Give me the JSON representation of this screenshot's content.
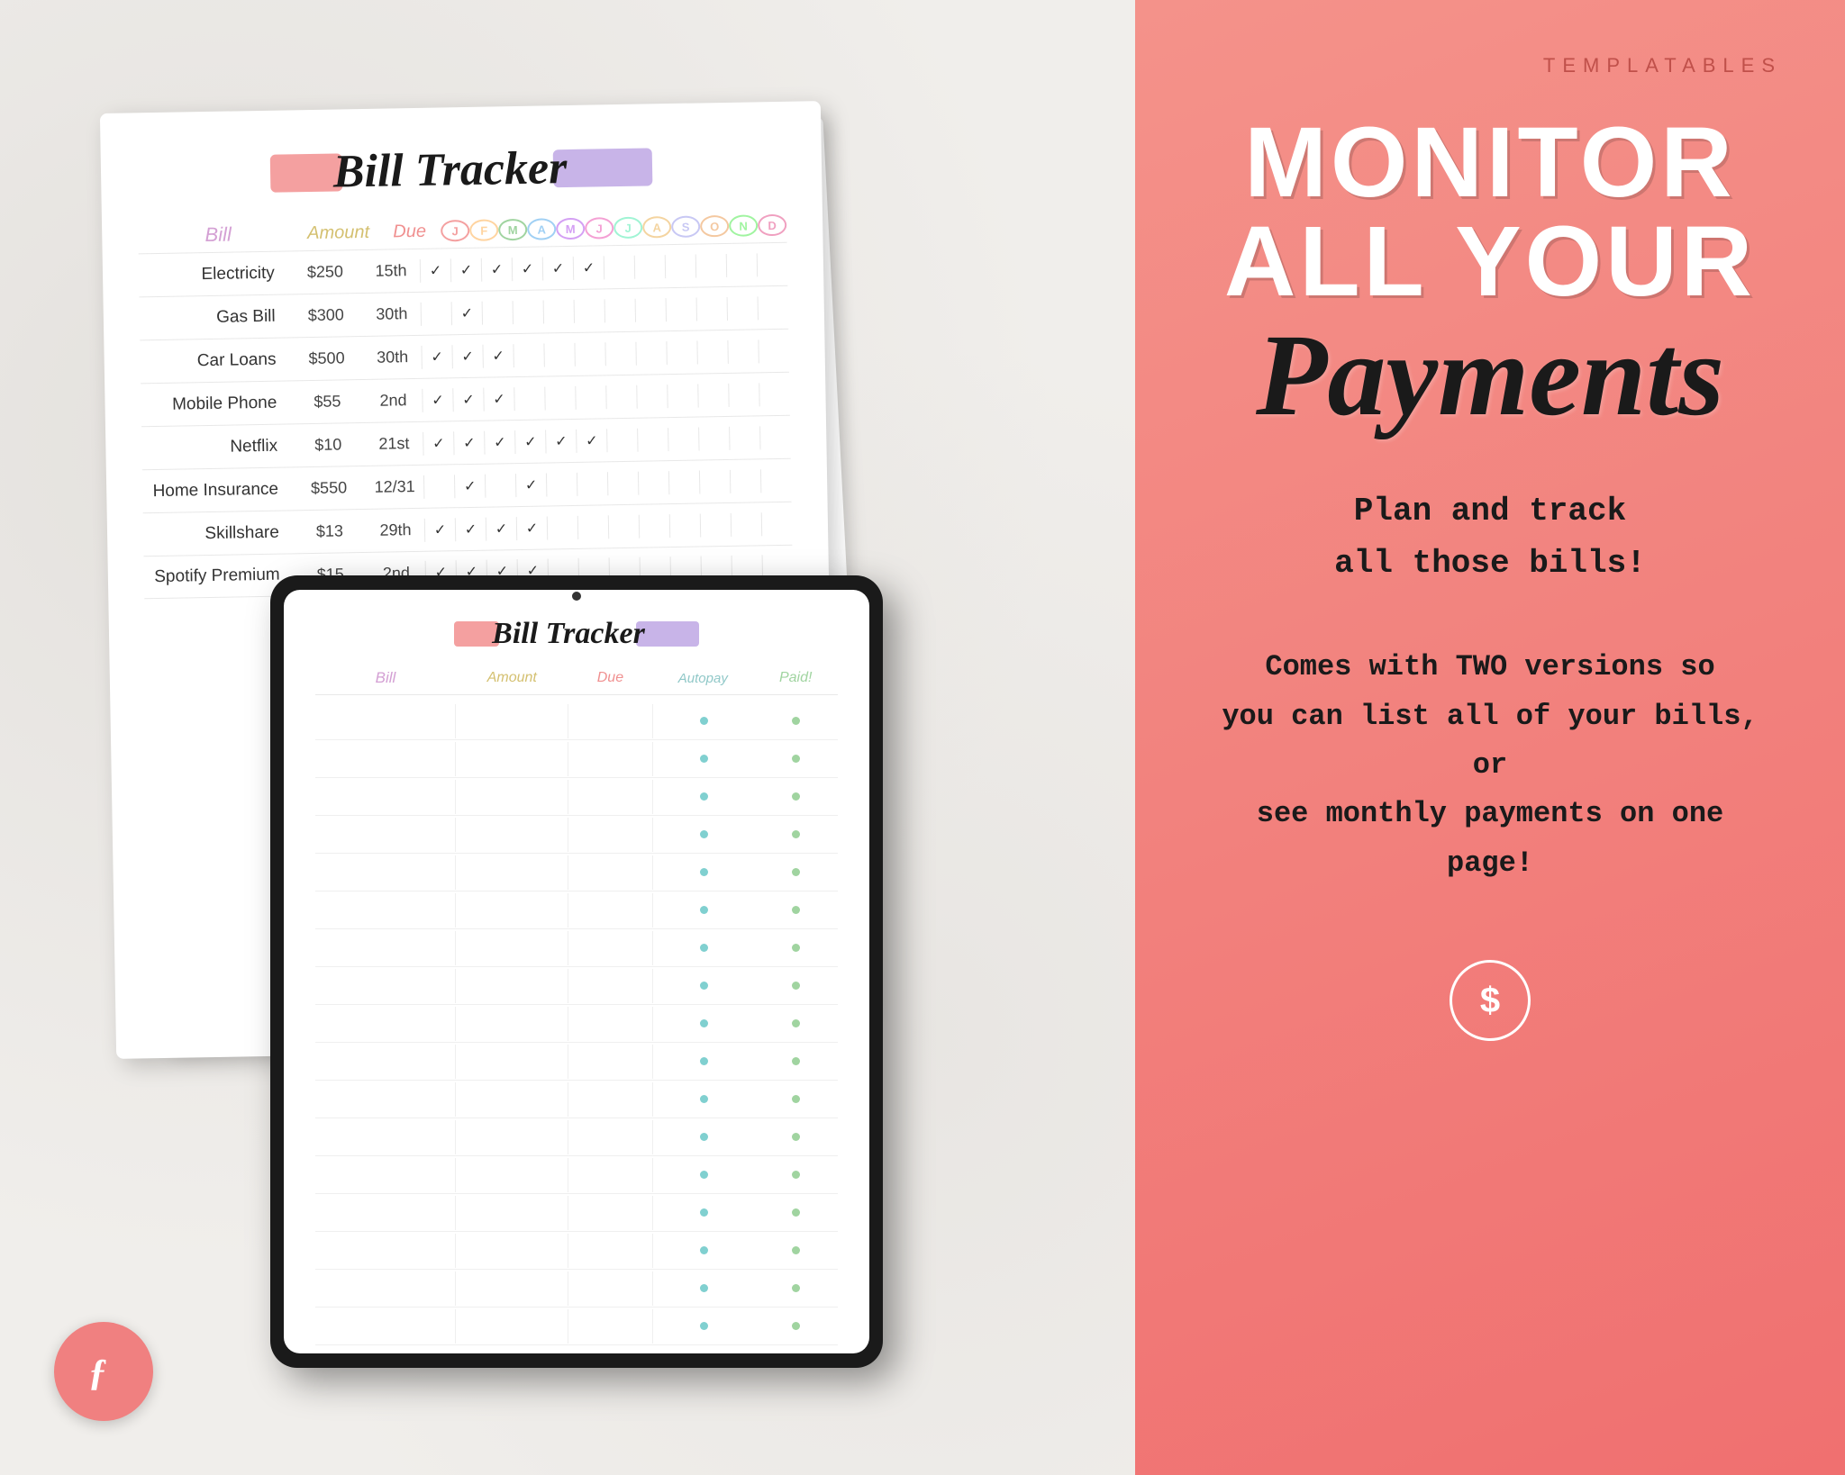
{
  "brand": "TEMPLATABLES",
  "right": {
    "monitor_line1": "MONITOR",
    "monitor_line2": "ALL YOUR",
    "payments_label": "Payments",
    "plan_text": "Plan and track\nall those bills!",
    "comes_text": "Comes with TWO versions so\nyou can list all of your bills, or\nsee monthly payments on one\npage!",
    "dollar_symbol": "$"
  },
  "paper": {
    "title": "Bill Tracker",
    "headers": {
      "bill": "Bill",
      "amount": "Amount",
      "due": "Due",
      "months": [
        "J",
        "F",
        "M",
        "A",
        "M",
        "J",
        "J",
        "A",
        "S",
        "O",
        "N",
        "D"
      ]
    },
    "rows": [
      {
        "bill": "Electricity",
        "amount": "$250",
        "due": "15th",
        "checks": [
          1,
          1,
          1,
          1,
          1,
          1,
          0,
          0,
          0,
          0,
          0,
          0
        ]
      },
      {
        "bill": "Gas Bill",
        "amount": "$300",
        "due": "30th",
        "checks": [
          0,
          1,
          0,
          0,
          0,
          0,
          0,
          0,
          0,
          0,
          0,
          0
        ]
      },
      {
        "bill": "Car Loans",
        "amount": "$500",
        "due": "30th",
        "checks": [
          1,
          1,
          1,
          0,
          0,
          0,
          0,
          0,
          0,
          0,
          0,
          0
        ]
      },
      {
        "bill": "Mobile Phone",
        "amount": "$55",
        "due": "2nd",
        "checks": [
          1,
          1,
          1,
          0,
          0,
          0,
          0,
          0,
          0,
          0,
          0,
          0
        ]
      },
      {
        "bill": "Netflix",
        "amount": "$10",
        "due": "21st",
        "checks": [
          1,
          1,
          1,
          1,
          1,
          1,
          0,
          0,
          0,
          0,
          0,
          0
        ]
      },
      {
        "bill": "Home Insurance",
        "amount": "$550",
        "due": "12/31",
        "checks": [
          0,
          1,
          0,
          1,
          0,
          0,
          0,
          0,
          0,
          0,
          0,
          0
        ]
      },
      {
        "bill": "Skillshare",
        "amount": "$13",
        "due": "29th",
        "checks": [
          1,
          1,
          1,
          1,
          0,
          0,
          0,
          0,
          0,
          0,
          0,
          0
        ]
      },
      {
        "bill": "Spotify Premium",
        "amount": "$15",
        "due": "2nd",
        "checks": [
          1,
          1,
          1,
          1,
          0,
          0,
          0,
          0,
          0,
          0,
          0,
          0
        ]
      }
    ],
    "month_colors": [
      "#f4a0a0",
      "#ffd4a0",
      "#a0d4a0",
      "#a0d0f4",
      "#d4a0f4",
      "#f4a0d4",
      "#a0f4d4",
      "#f4d4a0",
      "#c8c8f4",
      "#f4c8a0",
      "#a0f4a0",
      "#f0a0c0"
    ]
  },
  "tablet": {
    "title": "Bill Tracker",
    "headers": {
      "bill": "Bill",
      "amount": "Amount",
      "due": "Due",
      "autopay": "Autopay",
      "paid": "Paid!"
    },
    "num_rows": 17
  },
  "logo": "ƒ"
}
